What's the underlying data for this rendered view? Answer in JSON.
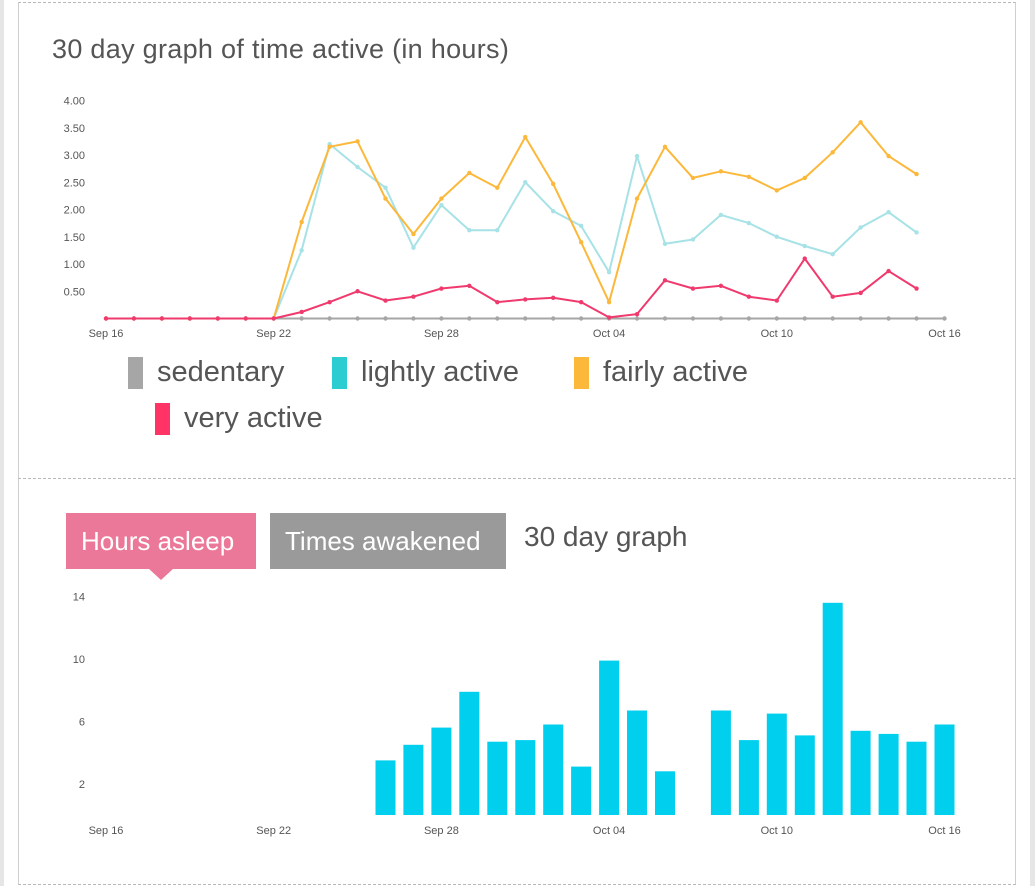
{
  "activity": {
    "title": "30 day graph of time active (in hours)",
    "legend": [
      "sedentary",
      "lightly active",
      "fairly active",
      "very active"
    ]
  },
  "sleep": {
    "tabs": [
      "Hours asleep",
      "Times awakened"
    ],
    "graph_label": "30 day graph"
  },
  "colors": {
    "sedentary": "#a6a6a6",
    "lightly": "#2ccdd0",
    "lightly_line": "#a6e2e6",
    "fairly": "#fcb83a",
    "very": "#ff3366",
    "very_line": "#f03a6e",
    "bars": "#00cfee",
    "tab_active": "#ec7899",
    "tab_inactive": "#9a9a9a"
  },
  "chart_data": [
    {
      "type": "line",
      "title": "30 day graph of time active (in hours)",
      "x": [
        "Sep 16",
        "Sep 17",
        "Sep 18",
        "Sep 19",
        "Sep 20",
        "Sep 21",
        "Sep 22",
        "Sep 23",
        "Sep 24",
        "Sep 25",
        "Sep 26",
        "Sep 27",
        "Sep 28",
        "Sep 29",
        "Sep 30",
        "Oct 01",
        "Oct 02",
        "Oct 03",
        "Oct 04",
        "Oct 05",
        "Oct 06",
        "Oct 07",
        "Oct 08",
        "Oct 09",
        "Oct 10",
        "Oct 11",
        "Oct 12",
        "Oct 13",
        "Oct 14",
        "Oct 15",
        "Oct 16"
      ],
      "x_tick_labels": [
        "Sep 16",
        "Sep 22",
        "Sep 28",
        "Oct 04",
        "Oct 10",
        "Oct 16"
      ],
      "y_tick_labels": [
        "4.00",
        "3.50",
        "3.00",
        "2.50",
        "2.00",
        "1.50",
        "1.00",
        "0.50"
      ],
      "ylim": [
        0,
        4.0
      ],
      "series": [
        {
          "name": "sedentary",
          "values": [
            0,
            0,
            0,
            0,
            0,
            0,
            0,
            0,
            0,
            0,
            0,
            0,
            0,
            0,
            0,
            0,
            0,
            0,
            0,
            0,
            0,
            0,
            0,
            0,
            0,
            0,
            0,
            0,
            0,
            0,
            0
          ]
        },
        {
          "name": "lightly active",
          "values": [
            0,
            0,
            0,
            0,
            0,
            0,
            0,
            1.25,
            3.2,
            2.78,
            2.4,
            1.3,
            2.08,
            1.62,
            1.62,
            2.5,
            1.97,
            1.7,
            0.85,
            2.98,
            1.37,
            1.45,
            1.9,
            1.75,
            1.5,
            1.33,
            1.18,
            1.67,
            1.95,
            1.58,
            null
          ]
        },
        {
          "name": "fairly active",
          "values": [
            0,
            0,
            0,
            0,
            0,
            0,
            0,
            1.77,
            3.15,
            3.25,
            2.2,
            1.55,
            2.2,
            2.67,
            2.4,
            3.33,
            2.47,
            1.4,
            0.3,
            2.2,
            3.15,
            2.58,
            2.7,
            2.6,
            2.35,
            2.58,
            3.05,
            3.6,
            2.98,
            2.65,
            null
          ]
        },
        {
          "name": "very active",
          "values": [
            0,
            0,
            0,
            0,
            0,
            0,
            0,
            0.12,
            0.3,
            0.5,
            0.33,
            0.4,
            0.55,
            0.6,
            0.3,
            0.35,
            0.38,
            0.3,
            0.02,
            0.08,
            0.7,
            0.55,
            0.6,
            0.4,
            0.33,
            1.1,
            0.4,
            0.47,
            0.87,
            0.55,
            null
          ]
        }
      ]
    },
    {
      "type": "bar",
      "x": [
        "Sep 16",
        "Sep 17",
        "Sep 18",
        "Sep 19",
        "Sep 20",
        "Sep 21",
        "Sep 22",
        "Sep 23",
        "Sep 24",
        "Sep 25",
        "Sep 26",
        "Sep 27",
        "Sep 28",
        "Sep 29",
        "Sep 30",
        "Oct 01",
        "Oct 02",
        "Oct 03",
        "Oct 04",
        "Oct 05",
        "Oct 06",
        "Oct 07",
        "Oct 08",
        "Oct 09",
        "Oct 10",
        "Oct 11",
        "Oct 12",
        "Oct 13",
        "Oct 14",
        "Oct 15",
        "Oct 16"
      ],
      "x_tick_labels": [
        "Sep 16",
        "Sep 22",
        "Sep 28",
        "Oct 04",
        "Oct 10",
        "Oct 16"
      ],
      "y_tick_labels": [
        "14",
        "10",
        "6",
        "2"
      ],
      "ylim": [
        0,
        14
      ],
      "series": [
        {
          "values": [
            0,
            0,
            0,
            0,
            0,
            0,
            0,
            0,
            0,
            0,
            3.5,
            4.5,
            5.6,
            7.9,
            4.7,
            4.8,
            5.8,
            3.1,
            9.9,
            6.7,
            2.8,
            0,
            6.7,
            4.8,
            6.5,
            5.1,
            13.6,
            5.4,
            5.2,
            4.7,
            5.8
          ]
        }
      ]
    }
  ]
}
